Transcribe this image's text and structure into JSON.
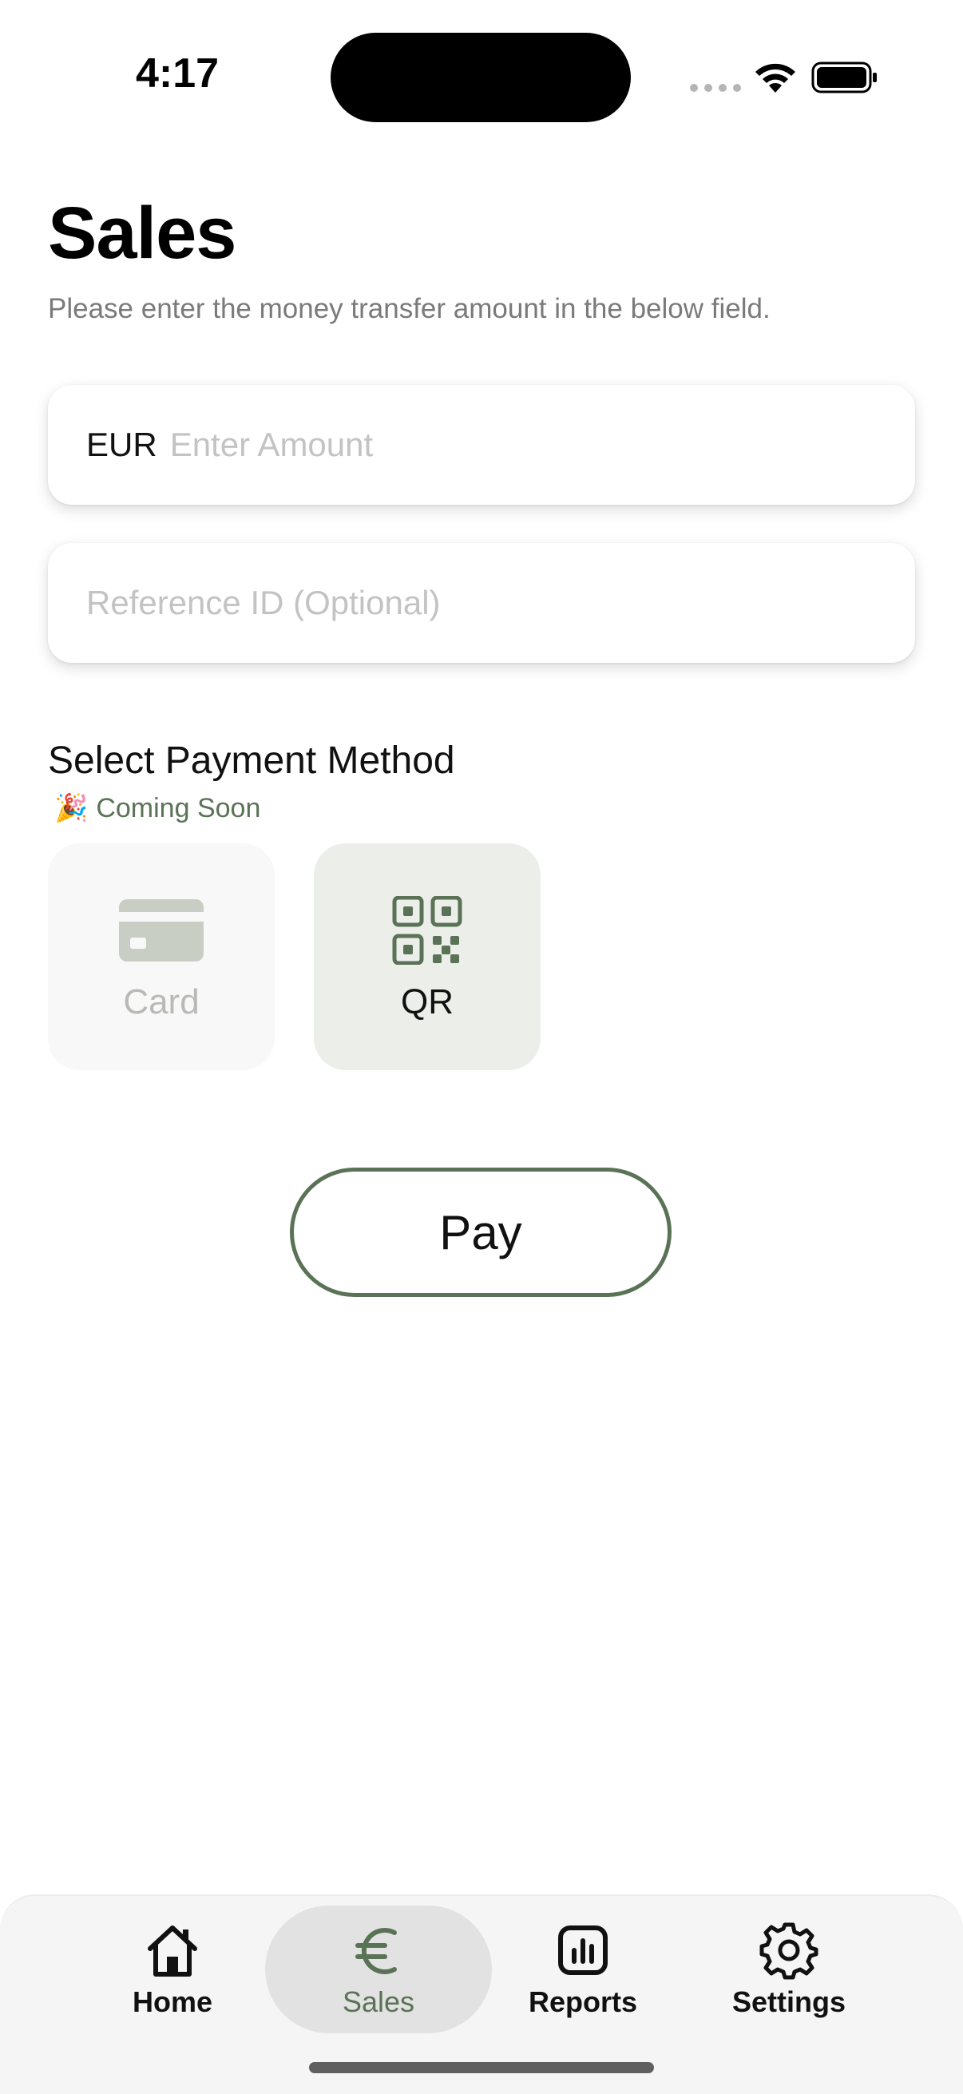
{
  "status_bar": {
    "time": "4:17"
  },
  "header": {
    "title": "Sales",
    "subtitle": "Please enter the money transfer amount in the below field."
  },
  "amount_field": {
    "currency": "EUR",
    "placeholder": "Enter Amount",
    "value": ""
  },
  "reference_field": {
    "placeholder": "Reference ID (Optional)",
    "value": ""
  },
  "payment": {
    "section_title": "Select Payment Method",
    "coming_soon_emoji": "🎉",
    "coming_soon_label": "Coming Soon",
    "methods": [
      {
        "label": "Card",
        "icon": "credit-card-icon",
        "enabled": false
      },
      {
        "label": "QR",
        "icon": "qr-code-icon",
        "enabled": true
      }
    ]
  },
  "pay_button": {
    "label": "Pay"
  },
  "tab_bar": {
    "items": [
      {
        "label": "Home",
        "icon": "home-icon",
        "active": false
      },
      {
        "label": "Sales",
        "icon": "euro-icon",
        "active": true
      },
      {
        "label": "Reports",
        "icon": "bar-chart-icon",
        "active": false
      },
      {
        "label": "Settings",
        "icon": "gear-icon",
        "active": false
      }
    ]
  },
  "colors": {
    "accent": "#5a7356",
    "disabled": "#c9cec5",
    "placeholder": "#c3c3c3"
  }
}
